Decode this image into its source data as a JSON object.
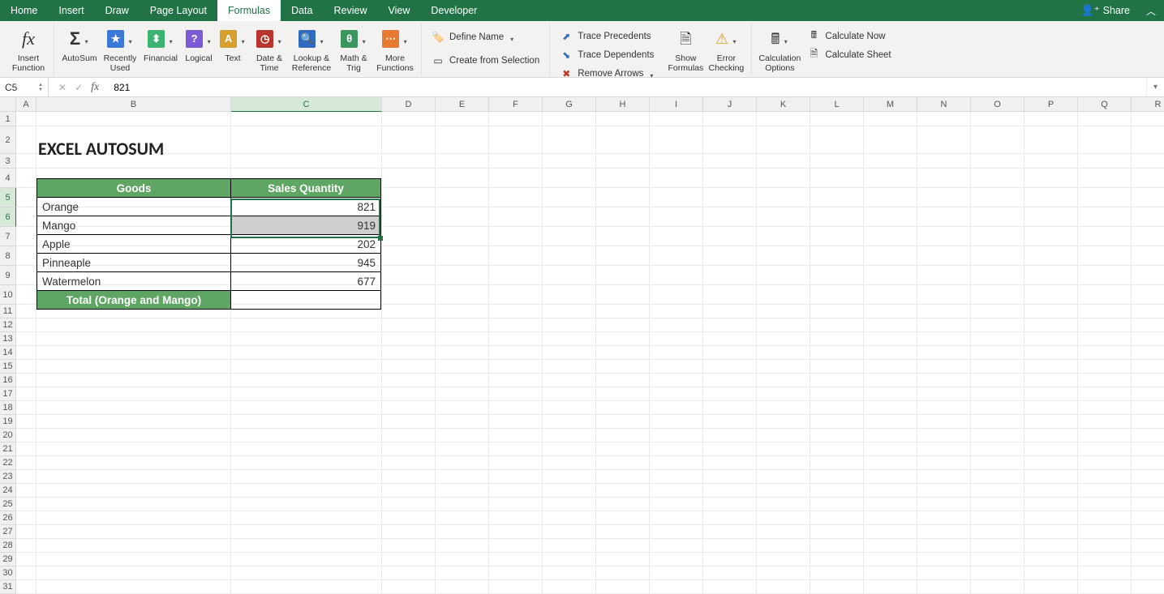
{
  "tabs": {
    "items": [
      "Home",
      "Insert",
      "Draw",
      "Page Layout",
      "Formulas",
      "Data",
      "Review",
      "View",
      "Developer"
    ],
    "active": "Formulas",
    "share_label": "Share"
  },
  "ribbon": {
    "insert_function": "Insert\nFunction",
    "autosum": "AutoSum",
    "recently_used": "Recently\nUsed",
    "financial": "Financial",
    "logical": "Logical",
    "text": "Text",
    "date_time": "Date &\nTime",
    "lookup_ref": "Lookup &\nReference",
    "math_trig": "Math &\nTrig",
    "more_functions": "More\nFunctions",
    "define_name": "Define Name",
    "create_from_selection": "Create from Selection",
    "trace_precedents": "Trace Precedents",
    "trace_dependents": "Trace Dependents",
    "remove_arrows": "Remove Arrows",
    "show_formulas": "Show\nFormulas",
    "error_checking": "Error\nChecking",
    "calc_options": "Calculation\nOptions",
    "calc_now": "Calculate Now",
    "calc_sheet": "Calculate Sheet"
  },
  "formula_bar": {
    "cell_ref": "C5",
    "formula_text": "821"
  },
  "columns": [
    "A",
    "B",
    "C",
    "D",
    "E",
    "F",
    "G",
    "H",
    "I",
    "J",
    "K",
    "L",
    "M",
    "N",
    "O",
    "P",
    "Q",
    "R"
  ],
  "row_count": 31,
  "selected_rows": [
    5,
    6
  ],
  "selected_col": "C",
  "sheet": {
    "title": "EXCEL AUTOSUM",
    "headers": {
      "goods": "Goods",
      "qty": "Sales Quantity"
    },
    "rows": [
      {
        "goods": "Orange",
        "qty": "821"
      },
      {
        "goods": "Mango",
        "qty": "919"
      },
      {
        "goods": "Apple",
        "qty": "202"
      },
      {
        "goods": "Pinneaple",
        "qty": "945"
      },
      {
        "goods": "Watermelon",
        "qty": "677"
      }
    ],
    "total_label": "Total (Orange and Mango)",
    "total_value": ""
  }
}
